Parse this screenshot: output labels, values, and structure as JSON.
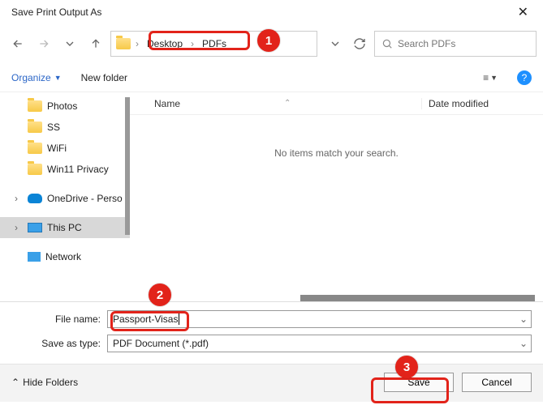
{
  "window": {
    "title": "Save Print Output As"
  },
  "breadcrumb": {
    "seg1": "Desktop",
    "seg2": "PDFs"
  },
  "search": {
    "placeholder": "Search PDFs"
  },
  "toolbar": {
    "organize": "Organize",
    "newfolder": "New folder"
  },
  "tree": {
    "photos": "Photos",
    "ss": "SS",
    "wifi": "WiFi",
    "win11": "Win11 Privacy",
    "onedrive": "OneDrive - Perso",
    "thispc": "This PC",
    "network": "Network"
  },
  "columns": {
    "name": "Name",
    "date": "Date modified"
  },
  "content": {
    "empty": "No items match your search."
  },
  "form": {
    "filename_label": "File name:",
    "filename_value": "Passport-Visas",
    "type_label": "Save as type:",
    "type_value": "PDF Document (*.pdf)"
  },
  "footer": {
    "hide": "Hide Folders",
    "save": "Save",
    "cancel": "Cancel"
  },
  "callouts": {
    "c1": "1",
    "c2": "2",
    "c3": "3"
  }
}
